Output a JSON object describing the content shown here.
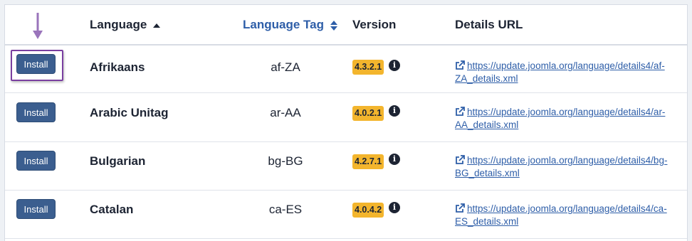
{
  "header": {
    "language": "Language",
    "language_tag": "Language Tag",
    "version": "Version",
    "details_url": "Details URL"
  },
  "colors": {
    "accent": "#2e5ea8",
    "button": "#3b5e8f",
    "badge": "#f3b52d",
    "highlight": "#7a3fa0",
    "pointer_arrow": "#9a74bb"
  },
  "rows": [
    {
      "action": "Install",
      "language": "Afrikaans",
      "tag": "af-ZA",
      "version": "4.3.2.1",
      "url_line1": "https://update.joomla.org/language/details4/af-",
      "url_line2": "ZA_details.xml"
    },
    {
      "action": "Install",
      "language": "Arabic Unitag",
      "tag": "ar-AA",
      "version": "4.0.2.1",
      "url_line1": "https://update.joomla.org/language/details4/ar-",
      "url_line2": "AA_details.xml"
    },
    {
      "action": "Install",
      "language": "Bulgarian",
      "tag": "bg-BG",
      "version": "4.2.7.1",
      "url_line1": "https://update.joomla.org/language/details4/bg-",
      "url_line2": "BG_details.xml"
    },
    {
      "action": "Install",
      "language": "Catalan",
      "tag": "ca-ES",
      "version": "4.0.4.2",
      "url_line1": "https://update.joomla.org/language/details4/ca-",
      "url_line2": "ES_details.xml"
    }
  ]
}
